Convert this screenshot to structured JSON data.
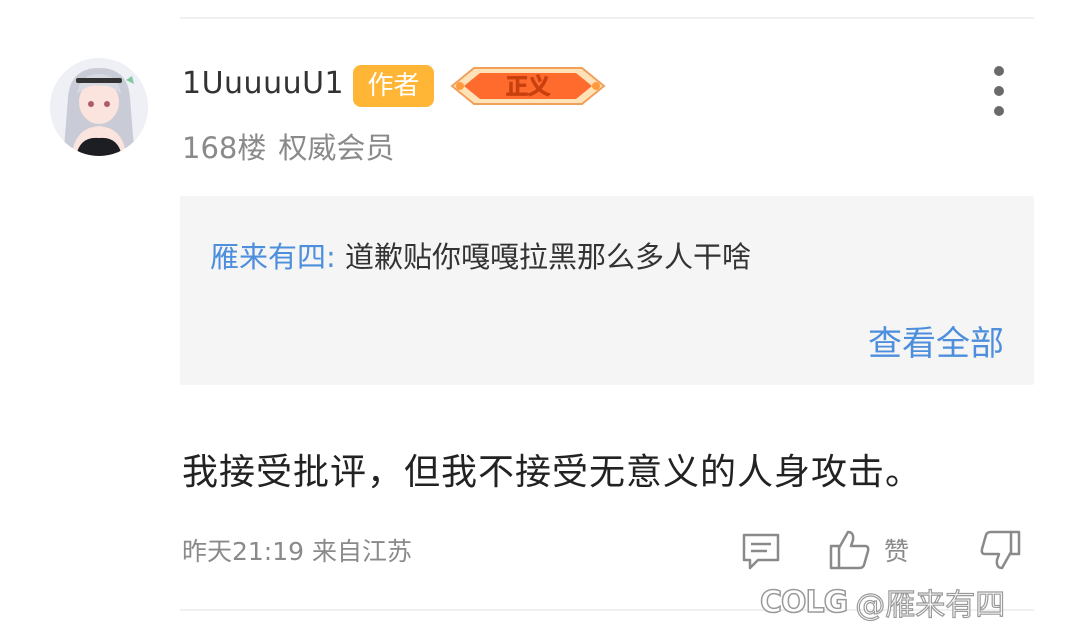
{
  "post": {
    "username": "1UuuuuU1",
    "author_badge": "作者",
    "level_badge": "正义",
    "floor": "168楼",
    "member_title": "权威会员",
    "body": "我接受批评，但我不接受无意义的人身攻击。",
    "time_location": "昨天21:19 来自江苏"
  },
  "quote": {
    "author": "雁来有四:",
    "text": "道歉贴你嘎嘎拉黑那么多人干啥",
    "view_all": "查看全部"
  },
  "actions": {
    "like_label": "赞"
  },
  "watermark": {
    "logo": "COLG",
    "handle": "@雁来有四"
  },
  "colors": {
    "link_blue": "#4d8fdc",
    "author_badge_orange": "#ffb637",
    "meta_gray": "#8a8a8a",
    "quote_bg": "#f5f5f5"
  }
}
